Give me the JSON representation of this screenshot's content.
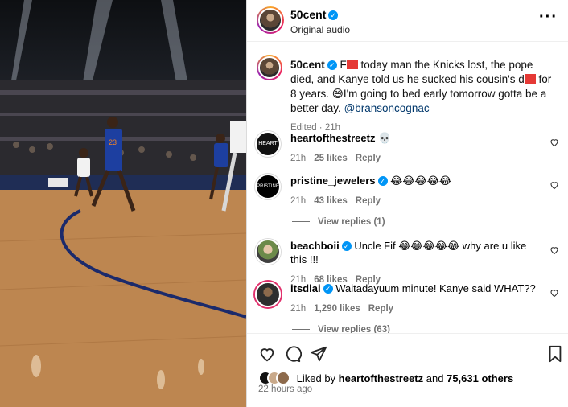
{
  "post": {
    "username": "50cent",
    "audio": "Original audio"
  },
  "caption": {
    "username": "50cent",
    "text_a": "F",
    "text_b": " today man the Knicks lost, the pope died, and Kanye told us he sucked his cousin's d",
    "text_c": " for 8 years. 😅I'm going to bed early tomorrow gotta be a better day.",
    "mention": "@bransoncognac",
    "edited": "Edited",
    "time": "21h"
  },
  "comments": [
    {
      "username": "heartofthestreetz",
      "text": "💀",
      "time": "21h",
      "likes": "25 likes",
      "reply": "Reply",
      "verified": false
    },
    {
      "username": "pristine_jewelers",
      "text": "😂😂😂😂😂",
      "time": "21h",
      "likes": "43 likes",
      "reply": "Reply",
      "verified": true,
      "view_replies": "View replies (1)"
    },
    {
      "username": "beachboii",
      "text": "Uncle Fif 😂😂😂😂😂 why are u like this !!!",
      "time": "21h",
      "likes": "68 likes",
      "reply": "Reply",
      "verified": true
    },
    {
      "username": "itsdlai",
      "text": "Waitadayuum minute! Kanye said WHAT??",
      "time": "21h",
      "likes": "1,290 likes",
      "reply": "Reply",
      "verified": true,
      "view_replies": "View replies (63)"
    }
  ],
  "footer": {
    "liked_by": "Liked by",
    "liked_user": "heartofthestreetz",
    "and": "and",
    "others": "75,631 others",
    "ago": "22 hours ago"
  },
  "icons": [
    "verified-badge-icon",
    "more-options-icon",
    "heart-icon",
    "comment-icon",
    "share-icon",
    "bookmark-icon"
  ],
  "colors": {
    "verified": "#0095f6",
    "mention": "#00376b",
    "meta": "#737373",
    "redaction": "#e53935"
  }
}
